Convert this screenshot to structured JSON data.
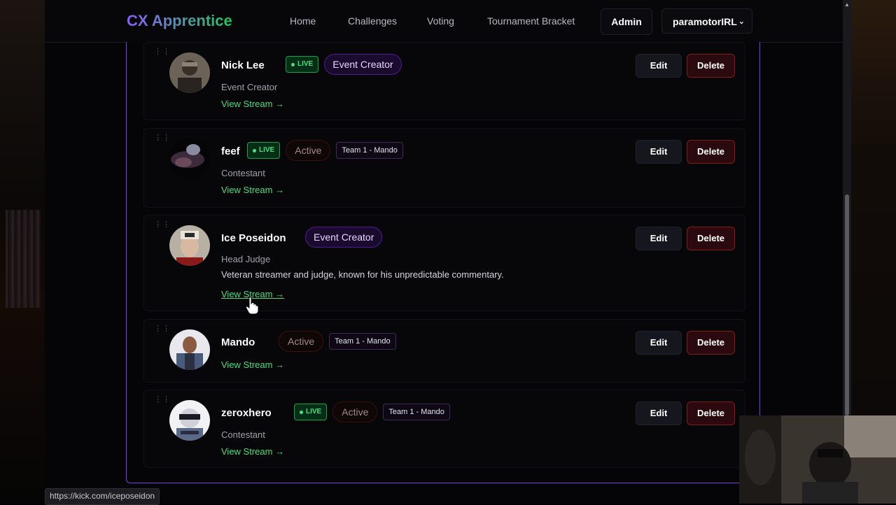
{
  "nav": {
    "logo": "CX Apprentice",
    "links": [
      "Home",
      "Challenges",
      "Voting",
      "Tournament Bracket"
    ],
    "admin": "Admin",
    "user": "paramotorIRL"
  },
  "buttons": {
    "edit": "Edit",
    "delete": "Delete"
  },
  "labels": {
    "live": "LIVE",
    "view_stream": "View Stream →"
  },
  "participants": [
    {
      "name": "Nick Lee",
      "live": true,
      "status": "Event Creator",
      "team": "",
      "role": "Event Creator",
      "description": ""
    },
    {
      "name": "feef",
      "live": true,
      "status": "Active",
      "team": "Team 1 - Mando",
      "role": "Contestant",
      "description": ""
    },
    {
      "name": "Ice Poseidon",
      "live": false,
      "status": "Event Creator",
      "team": "",
      "role": "Head Judge",
      "description": "Veteran streamer and judge, known for his unpredictable commentary."
    },
    {
      "name": "Mando",
      "live": false,
      "status": "Active",
      "team": "Team 1 - Mando",
      "role": "",
      "description": ""
    },
    {
      "name": "zeroxhero",
      "live": true,
      "status": "Active",
      "team": "Team 1 - Mando",
      "role": "Contestant",
      "description": ""
    }
  ],
  "status_url": "https://kick.com/iceposeidon",
  "colors": {
    "accent_purple": "#7c3aed",
    "live_green": "#4ade80",
    "delete_red": "#7f1d1d"
  }
}
